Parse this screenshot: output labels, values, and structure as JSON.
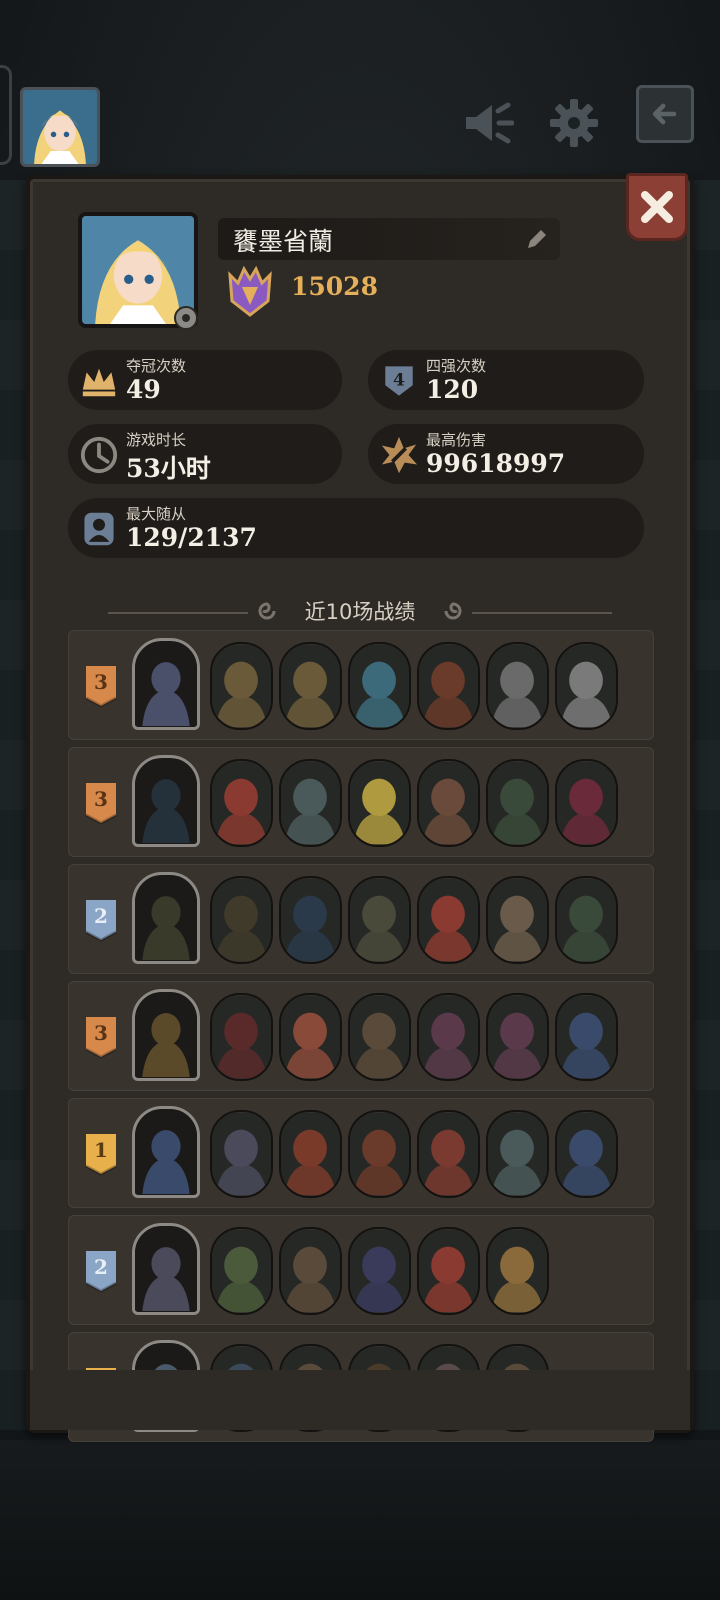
{
  "profile": {
    "name": "饔墨省蘭",
    "score": "15028",
    "icons": [
      "rank-crest-icon",
      "edit-pencil-icon",
      "settings-gear-icon"
    ]
  },
  "stats": [
    {
      "key": "champions",
      "label": "夺冠次数",
      "value": "49",
      "icon": "crown-icon"
    },
    {
      "key": "top4",
      "label": "四强次数",
      "value": "120",
      "icon": "four-shield-icon"
    },
    {
      "key": "playtime",
      "label": "游戏时长",
      "value": "53小时",
      "icon": "clock-icon"
    },
    {
      "key": "max_damage",
      "label": "最高伤害",
      "value": "99618997",
      "icon": "burst-icon"
    },
    {
      "key": "max_minions",
      "label": "最大随从",
      "value": "129/2137",
      "icon": "portrait-icon"
    }
  ],
  "section": {
    "title": "近10场战绩"
  },
  "topbar": {
    "icons": [
      "megaphone-icon",
      "settings-icon",
      "back-arrow-icon",
      "close-icon"
    ]
  },
  "matches": [
    {
      "rank": "3",
      "rank_color": "#d6894a",
      "hero_color": "#4a4f6a",
      "minions": [
        "#6b5a3a",
        "#6b5a3a",
        "#3c6a7a",
        "#6a3a2a",
        "#6a6a6a",
        "#7a7a7a"
      ]
    },
    {
      "rank": "3",
      "rank_color": "#d6894a",
      "hero_color": "#24303a",
      "minions": [
        "#8a3a30",
        "#4a5a5a",
        "#b09a40",
        "#6a4a3a",
        "#3a4a3a",
        "#6a2a3a"
      ]
    },
    {
      "rank": "2",
      "rank_color": "#8aa5c6",
      "hero_color": "#3a3a2a",
      "minions": [
        "#3f3a2a",
        "#2a3a4a",
        "#4a4a3a",
        "#8a3a30",
        "#6a5a4a",
        "#3a4a3a"
      ]
    },
    {
      "rank": "3",
      "rank_color": "#d6894a",
      "hero_color": "#5a4a2a",
      "minions": [
        "#5a2a2a",
        "#8a4a3a",
        "#5a4a3a",
        "#5a3a4a",
        "#5a3a4a",
        "#3a4a6a"
      ]
    },
    {
      "rank": "1",
      "rank_color": "#e8b04a",
      "hero_color": "#3a4a6a",
      "minions": [
        "#4a4a5a",
        "#7a3a2a",
        "#6a3a2a",
        "#7a3a30",
        "#4a5a5a",
        "#3a4a6a"
      ]
    },
    {
      "rank": "2",
      "rank_color": "#8aa5c6",
      "hero_color": "#4a4a5a",
      "minions": [
        "#4a5a3a",
        "#5a4a3a",
        "#3a3a5a",
        "#8a3a30",
        "#8a6a3a"
      ]
    },
    {
      "rank": "",
      "rank_color": "#e8b04a",
      "hero_color": "#4a5a6a",
      "minions": [
        "#3a4a5a",
        "#5a4a3a",
        "#4a3a2a",
        "#5a4a4a",
        "#5a4a3a"
      ]
    }
  ]
}
